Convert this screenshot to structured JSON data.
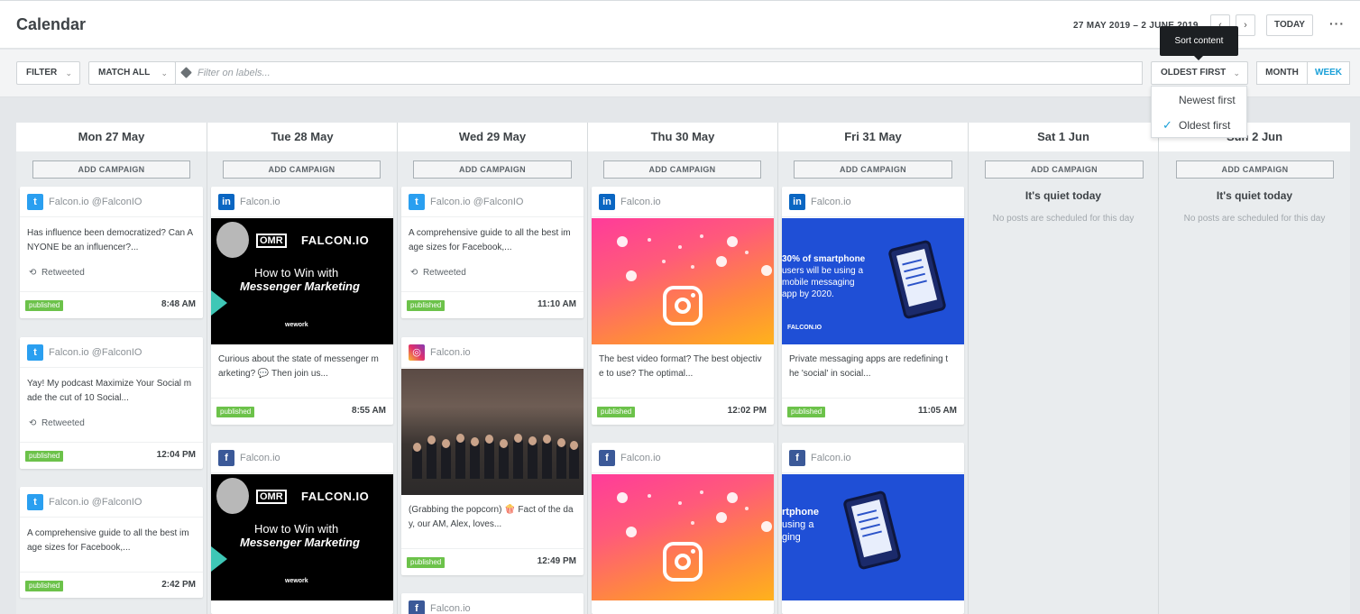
{
  "header": {
    "title": "Calendar",
    "date_range": "27 MAY 2019  –  2 JUNE 2019",
    "prev_icon": "‹",
    "next_icon": "›",
    "today_label": "TODAY",
    "more_icon": "···"
  },
  "toolbar": {
    "filter_label": "FILTER",
    "match_label": "MATCH ALL",
    "labels_placeholder": "Filter on labels...",
    "sort_label": "OLDEST FIRST",
    "month_label": "MONTH",
    "week_label": "WEEK",
    "chevron": "⌄"
  },
  "tooltip": {
    "text": "Sort content"
  },
  "sort_menu": {
    "items": [
      "Newest first",
      "Oldest first"
    ],
    "selected": "Oldest first",
    "check": "✓"
  },
  "calendar": {
    "add_campaign": "ADD CAMPAIGN",
    "quiet_title": "It's quiet today",
    "quiet_sub": "No posts are scheduled for this day",
    "days": [
      "Mon 27 May",
      "Tue 28 May",
      "Wed 29 May",
      "Thu 30 May",
      "Fri 31 May",
      "Sat 1 Jun",
      "Sun 2 Jun"
    ]
  },
  "posts": {
    "mon1": {
      "network": "twitter",
      "account": "Falcon.io @FalconIO",
      "text": "Has influence been democratized? Can A NYONE be an influencer?...",
      "retweet": "Retweeted",
      "status": "published",
      "time": "8:48 AM"
    },
    "mon2": {
      "network": "twitter",
      "account": "Falcon.io @FalconIO",
      "text": "Yay! My podcast Maximize Your Social m ade the cut of 10 Social...",
      "retweet": "Retweeted",
      "status": "published",
      "time": "12:04 PM"
    },
    "mon3": {
      "network": "twitter",
      "account": "Falcon.io @FalconIO",
      "text": "A comprehensive guide to all the best im age sizes for Facebook,...",
      "status": "published",
      "time": "2:42 PM"
    },
    "tue1": {
      "network": "linkedin",
      "account": "Falcon.io",
      "image": {
        "omr": "OMR",
        "falcon": "FALCON.IO",
        "line1": "How to Win with",
        "line2": "Messenger Marketing",
        "sponsor": "wework"
      },
      "text": "Curious about the state of messenger m arketing? 💬 Then join us...",
      "status": "published",
      "time": "8:55 AM"
    },
    "tue2": {
      "network": "facebook",
      "account": "Falcon.io",
      "image": {
        "omr": "OMR",
        "falcon": "FALCON.IO",
        "line1": "How to Win with",
        "line2": "Messenger Marketing",
        "sponsor": "wework"
      }
    },
    "wed1": {
      "network": "twitter",
      "account": "Falcon.io @FalconIO",
      "text": "A comprehensive guide to all the best im age sizes for Facebook,...",
      "retweet": "Retweeted",
      "status": "published",
      "time": "11:10 AM"
    },
    "wed2": {
      "network": "instagram",
      "account": "Falcon.io",
      "text": "(Grabbing the popcorn) 🍿 Fact of the da y, our AM, Alex, loves...",
      "status": "published",
      "time": "12:49 PM"
    },
    "wed3": {
      "network": "facebook",
      "account": "Falcon.io"
    },
    "thu1": {
      "network": "linkedin",
      "account": "Falcon.io",
      "text": "The best video format? The best objectiv e to use? The optimal...",
      "status": "published",
      "time": "12:02 PM"
    },
    "thu2": {
      "network": "facebook",
      "account": "Falcon.io"
    },
    "fri1": {
      "network": "linkedin",
      "account": "Falcon.io",
      "image": {
        "line1": "30% of smartphone",
        "line2": "users will be using a",
        "line3": "mobile messaging",
        "line4": "app by 2020.",
        "logo": "FALCON.IO"
      },
      "text": "Private messaging apps are redefining t he 'social' in social...",
      "status": "published",
      "time": "11:05 AM"
    },
    "fri2": {
      "network": "facebook",
      "account": "Falcon.io",
      "image": {
        "line1": "rtphone",
        "line2": "using a",
        "line3": "ging"
      }
    }
  },
  "colors": {
    "published": "#6cc24a",
    "accent": "#1aa0d8",
    "twitter": "#2a9ff0",
    "linkedin": "#0a66c2",
    "facebook": "#3b5998"
  }
}
